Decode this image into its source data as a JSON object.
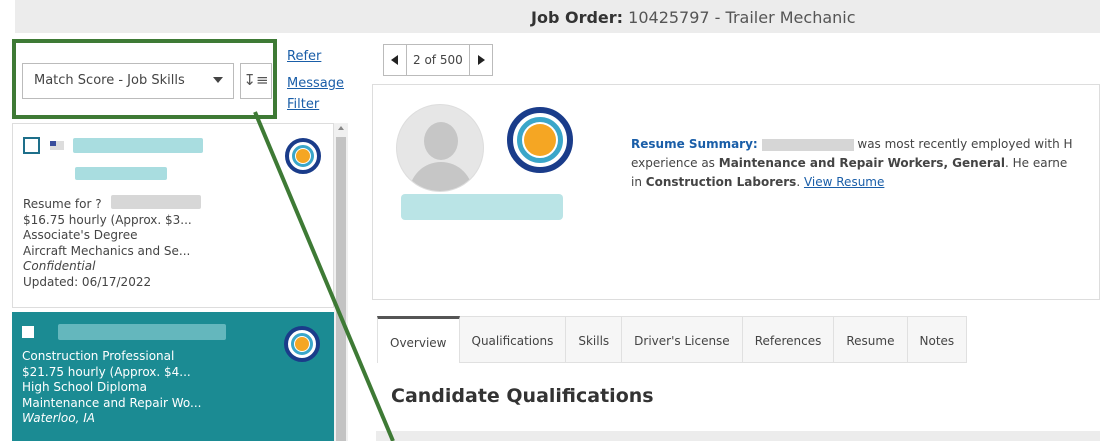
{
  "header": {
    "job_order_label": "Job Order:",
    "job_order_value": "10425797 - Trailer Mechanic"
  },
  "sidebar": {
    "sort_select_value": "Match Score - Job Skills",
    "sort_direction_icon": "sort-descending-icon",
    "links": {
      "refer": "Refer",
      "message": "Message",
      "filter": "Filter"
    },
    "candidates": [
      {
        "lines": [
          "Resume for ?",
          "$16.75 hourly (Approx. $3...",
          "Associate's Degree",
          "Aircraft Mechanics and Se...",
          "Confidential",
          "Updated: 06/17/2022"
        ],
        "selected": false
      },
      {
        "lines": [
          "Construction Professional",
          "$21.75 hourly (Approx. $4...",
          "High School Diploma",
          "Maintenance and Repair Wo...",
          "Waterloo, IA"
        ],
        "selected": true
      }
    ]
  },
  "pager": {
    "count_text": "2 of 500"
  },
  "summary": {
    "label": "Resume Summary:",
    "line1_text": "was most recently employed with H",
    "line2_prefix": "experience as ",
    "line2_bold": "Maintenance and Repair Workers, General",
    "line2_suffix": ". He earne",
    "line3_prefix": "in ",
    "line3_bold": "Construction Laborers",
    "line3_suffix": ". ",
    "view_resume_link": "View Resume"
  },
  "tabs": [
    "Overview",
    "Qualifications",
    "Skills",
    "Driver's License",
    "References",
    "Resume",
    "Notes"
  ],
  "main": {
    "section_title": "Candidate Qualifications"
  },
  "colors": {
    "accent_teal": "#1b8b93",
    "callout_green": "#3e7a35",
    "link_blue": "#1a5ea8",
    "score_orange": "#f5a623",
    "score_navy": "#1a3c8a"
  }
}
